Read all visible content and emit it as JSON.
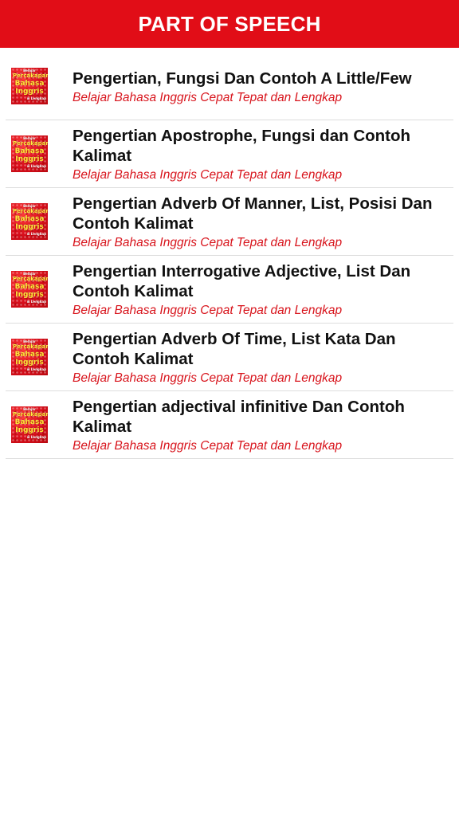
{
  "app_bar": {
    "title": "PART OF SPEECH"
  },
  "thumbnail": {
    "line1": "Belajar",
    "line2": "Percakapan",
    "line3": "Bahasa",
    "line4": "Inggris",
    "line5": "& Lengkap"
  },
  "articles": [
    {
      "title": "Pengertian, Fungsi Dan Contoh A Little/Few",
      "subtitle": "Belajar Bahasa Inggris Cepat Tepat dan Lengkap"
    },
    {
      "title": "Pengertian Apostrophe, Fungsi dan Contoh Kalimat",
      "subtitle": "Belajar Bahasa Inggris Cepat Tepat dan Lengkap"
    },
    {
      "title": "Pengertian Adverb Of Manner, List, Posisi Dan Contoh Kalimat",
      "subtitle": "Belajar Bahasa Inggris Cepat Tepat dan Lengkap"
    },
    {
      "title": "Pengertian Interrogative Adjective, List Dan Contoh Kalimat",
      "subtitle": "Belajar Bahasa Inggris Cepat Tepat dan Lengkap"
    },
    {
      "title": "Pengertian Adverb Of Time, List Kata Dan Contoh Kalimat",
      "subtitle": "Belajar Bahasa Inggris Cepat Tepat dan Lengkap"
    },
    {
      "title": "Pengertian adjectival infinitive Dan Contoh Kalimat",
      "subtitle": "Belajar Bahasa Inggris Cepat Tepat dan Lengkap"
    }
  ],
  "colors": {
    "accent": "#e10d17",
    "subtitle": "#d8141c",
    "divider": "#dddddd"
  }
}
